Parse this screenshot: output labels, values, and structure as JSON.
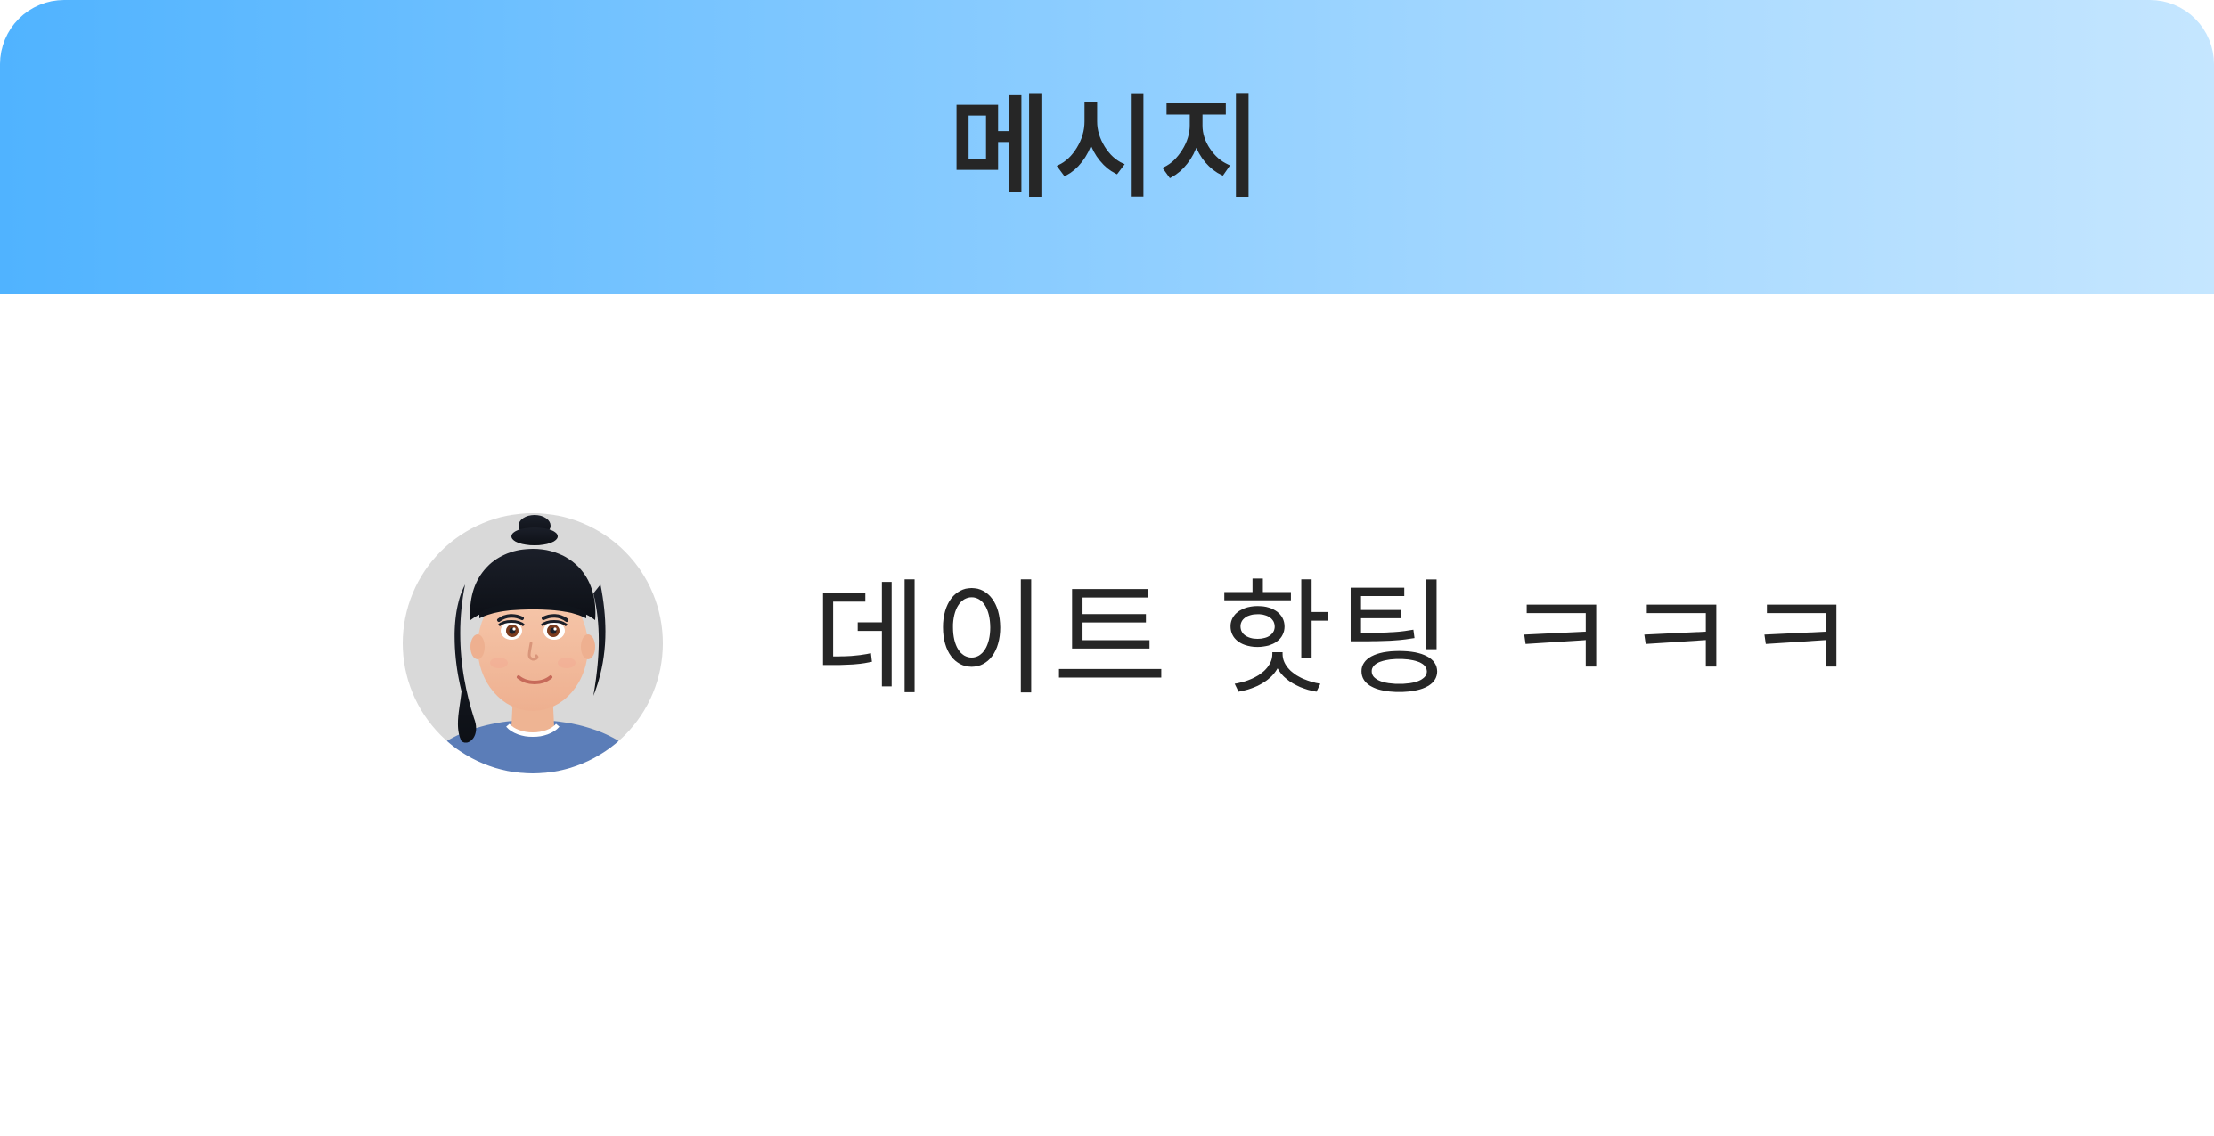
{
  "header": {
    "title": "메시지"
  },
  "message": {
    "avatar_icon": "user-avatar-icon",
    "text": "데이트 핫팅 ㅋㅋㅋ"
  },
  "colors": {
    "header_gradient_start": "#50b3ff",
    "header_gradient_end": "#c5e6ff",
    "text": "#262626",
    "avatar_background": "#d9d9d9"
  }
}
